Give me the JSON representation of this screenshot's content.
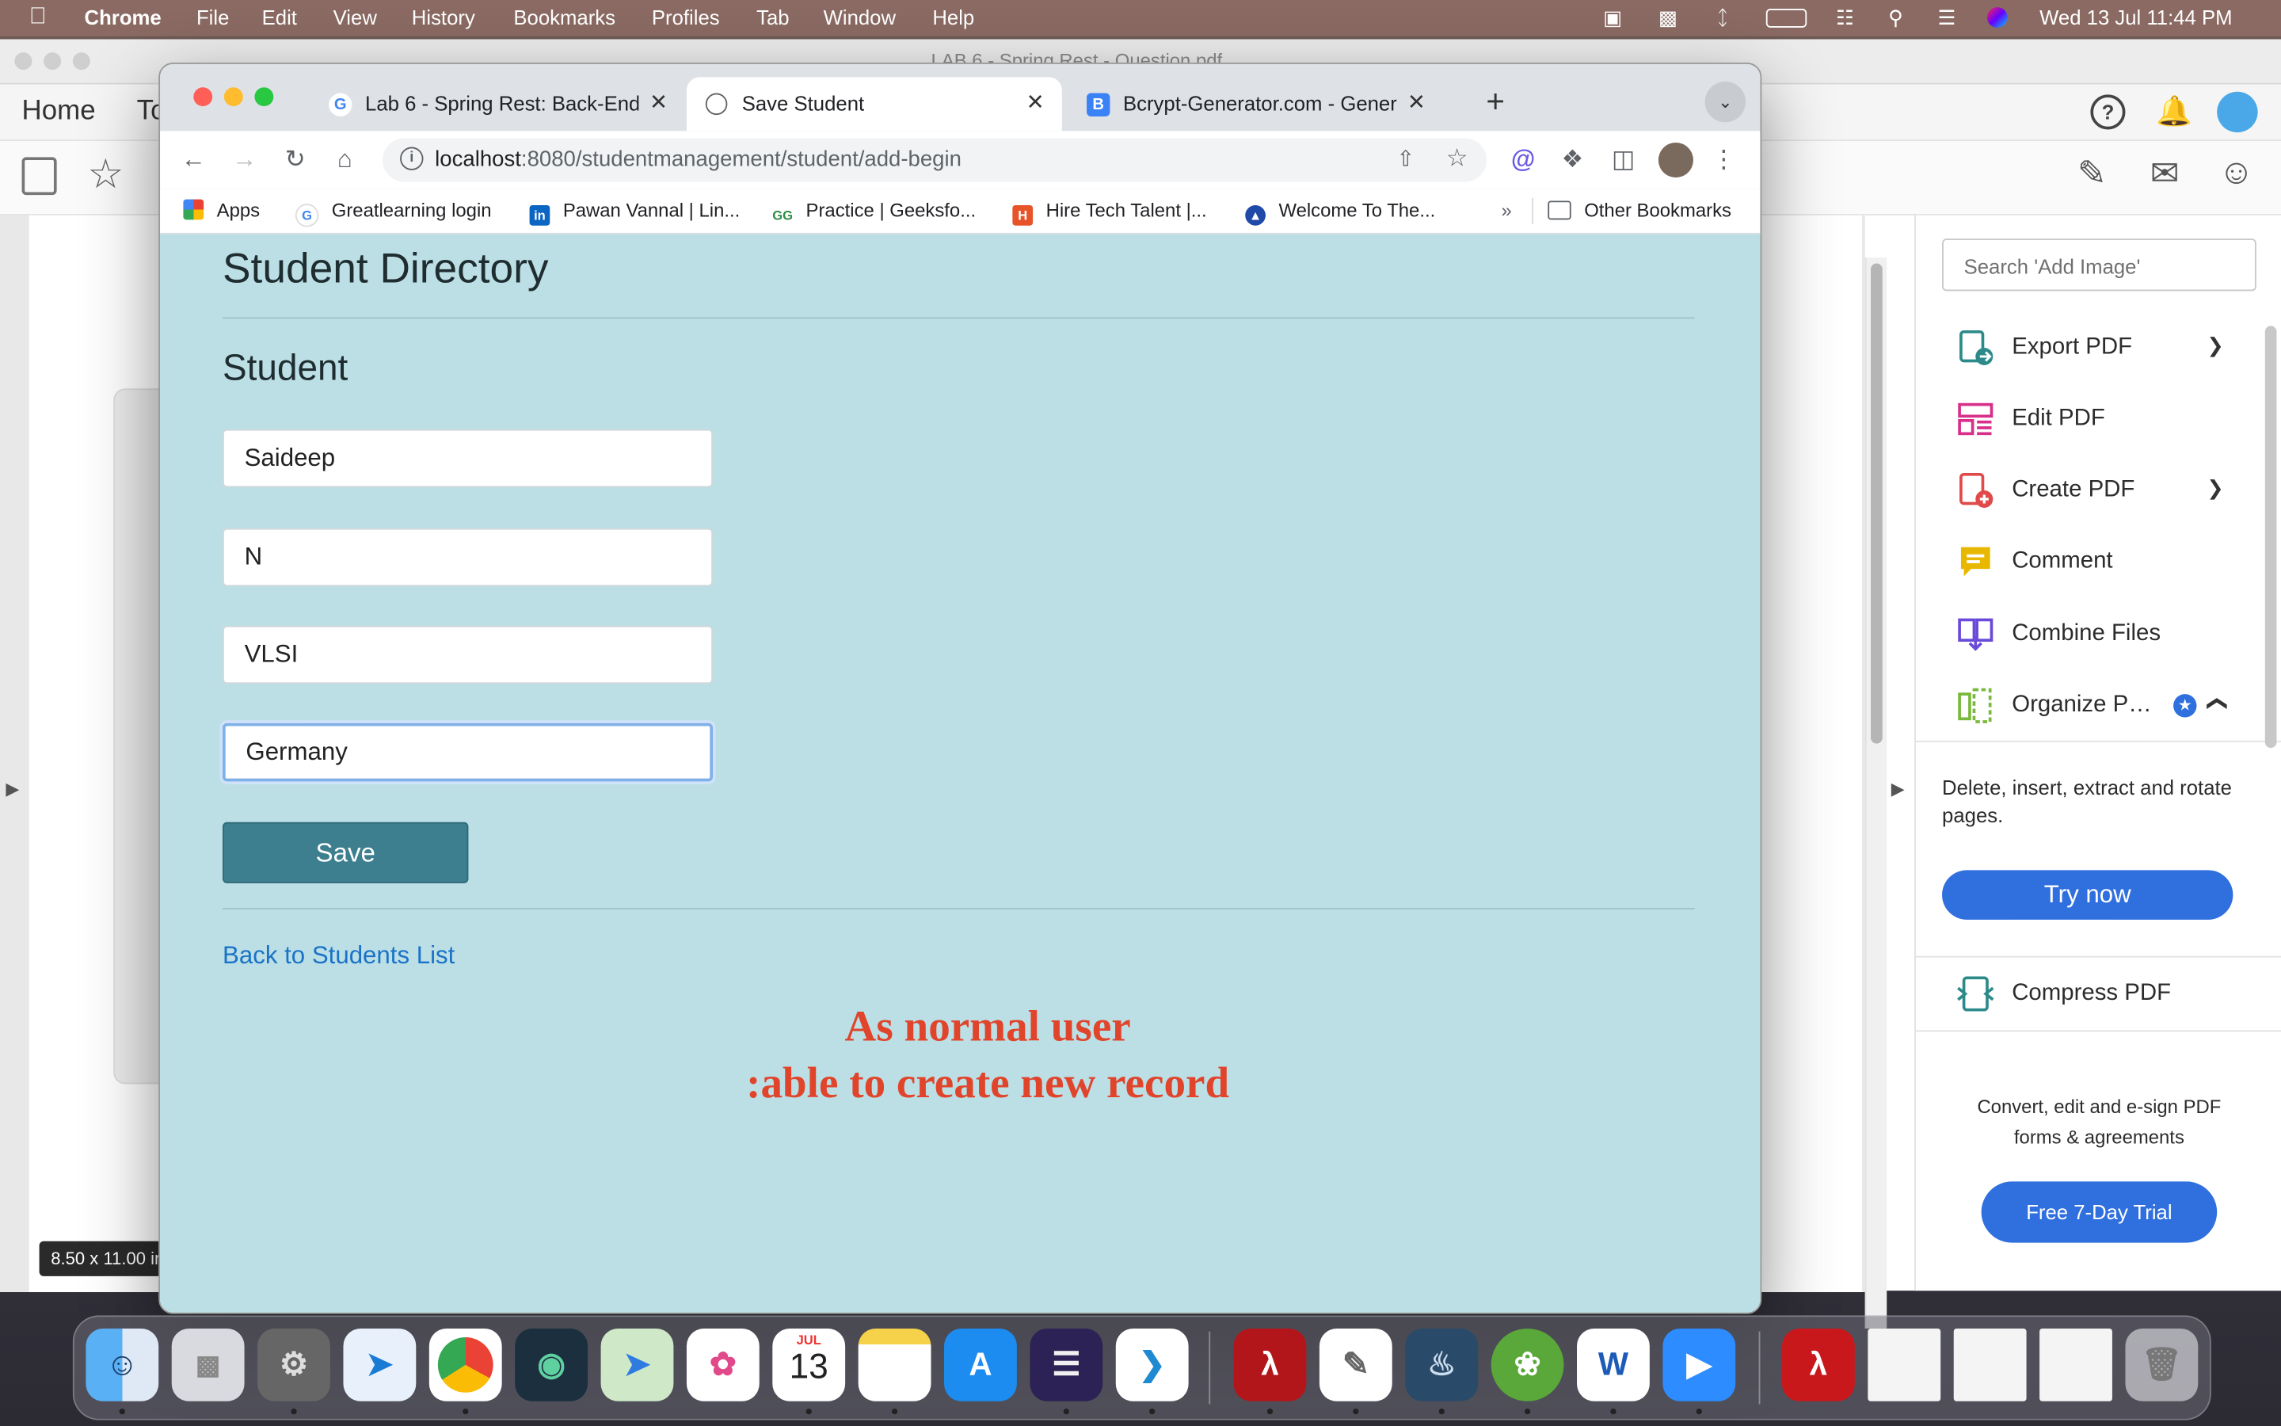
{
  "menubar": {
    "apple": "",
    "app_name": "Chrome",
    "items": [
      "File",
      "Edit",
      "View",
      "History",
      "Bookmarks",
      "Profiles",
      "Tab",
      "Window",
      "Help"
    ],
    "clock": "Wed 13 Jul  11:44 PM"
  },
  "acrobat": {
    "window_title": "LAB 6 - Spring Rest - Question.pdf",
    "menu_home": "Home",
    "menu_tools_partial": "To",
    "page_size": "8.50 x 11.00 in",
    "search_placeholder": "Search 'Add Image'",
    "tools": [
      {
        "label": "Export PDF",
        "icon": "export-pdf-icon",
        "color": "#2d8a8a"
      },
      {
        "label": "Edit PDF",
        "icon": "edit-pdf-icon",
        "color": "#d8308a"
      },
      {
        "label": "Create PDF",
        "icon": "create-pdf-icon",
        "color": "#e04a4a"
      },
      {
        "label": "Comment",
        "icon": "comment-icon",
        "color": "#e8b800"
      },
      {
        "label": "Combine Files",
        "icon": "combine-files-icon",
        "color": "#6a4ad8"
      },
      {
        "label": "Organize P…",
        "icon": "organize-pages-icon",
        "color": "#78b83a"
      },
      {
        "label": "Compress PDF",
        "icon": "compress-pdf-icon",
        "color": "#2d8a8a"
      }
    ],
    "organize_desc": "Delete, insert, extract and rotate pages.",
    "try_now": "Try now",
    "convert_text": "Convert, edit and e-sign PDF forms & agreements",
    "free_trial": "Free 7-Day Trial"
  },
  "chrome": {
    "tabs": [
      {
        "title": "Lab 6 - Spring Rest: Back-End",
        "favicon": "G",
        "active": false
      },
      {
        "title": "Save Student",
        "favicon": "globe",
        "active": true
      },
      {
        "title": "Bcrypt-Generator.com - Gener",
        "favicon": "B",
        "active": false
      }
    ],
    "url_host": "localhost",
    "url_path": ":8080/studentmanagement/student/add-begin",
    "bookmarks": [
      {
        "label": "Apps",
        "icon": "apps-grid-icon"
      },
      {
        "label": "Greatlearning login",
        "icon": "google-icon"
      },
      {
        "label": "Pawan Vannal | Lin...",
        "icon": "linkedin-icon"
      },
      {
        "label": "Practice | Geeksfo...",
        "icon": "geeksforgeeks-icon"
      },
      {
        "label": "Hire Tech Talent |...",
        "icon": "hire-icon"
      },
      {
        "label": "Welcome To The...",
        "icon": "welcome-icon"
      }
    ],
    "bookmarks_overflow": "»",
    "other_bookmarks": "Other Bookmarks"
  },
  "page": {
    "title": "Student Directory",
    "heading": "Student",
    "fields": [
      "Saideep",
      "N",
      "VLSI",
      "Germany"
    ],
    "save_label": "Save",
    "back_link": "Back to Students List",
    "annotation_line1": "As normal user",
    "annotation_line2": ":able to create new record"
  },
  "dock": {
    "calendar_month": "JUL",
    "calendar_day": "13",
    "apps": [
      "Finder",
      "Launchpad",
      "System Preferences",
      "Safari",
      "Chrome",
      "Sourcetree",
      "Maps",
      "Photos",
      "Calendar",
      "Notes",
      "App Store",
      "Eclipse",
      "VS Code",
      "Acrobat",
      "TextEdit",
      "MySQL Workbench",
      "Spring Tool Suite",
      "Word",
      "Zoom",
      "Acrobat Reader",
      "Document",
      "Document",
      "Document",
      "Trash"
    ]
  }
}
